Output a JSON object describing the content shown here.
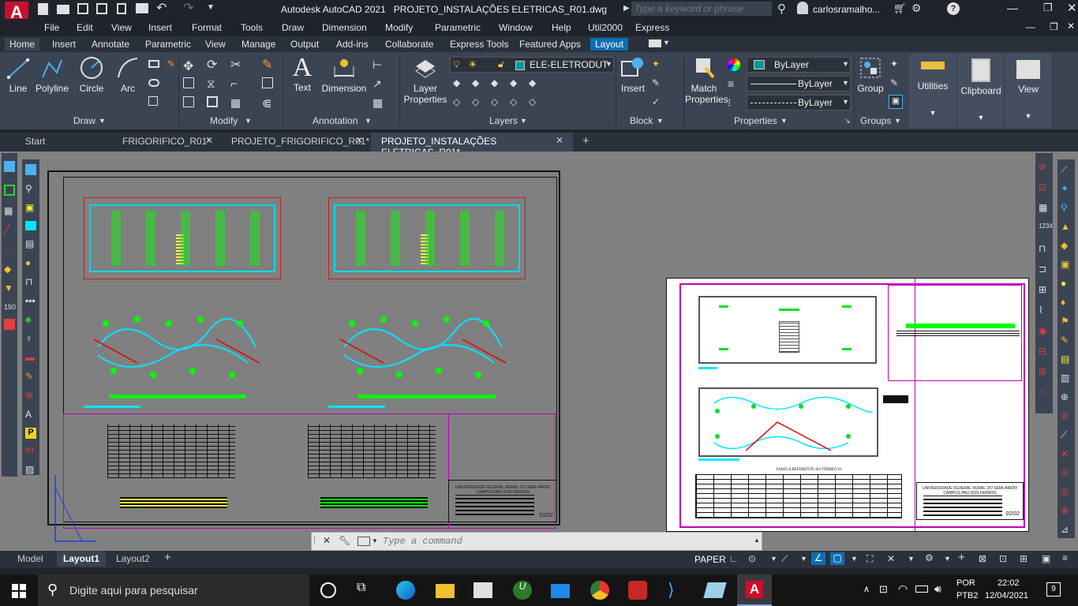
{
  "app": {
    "title": "Autodesk AutoCAD 2021",
    "filename": "PROJETO_INSTALAÇÕES ELETRICAS_R01.dwg",
    "search_placeholder": "Type a keyword or phrase",
    "user": "carlosramalho...",
    "logo_letter": "A"
  },
  "menu": [
    "File",
    "Edit",
    "View",
    "Insert",
    "Format",
    "Tools",
    "Draw",
    "Dimension",
    "Modify",
    "Parametric",
    "Window",
    "Help",
    "Util2000",
    "Express"
  ],
  "ribbon_tabs": [
    "Home",
    "Insert",
    "Annotate",
    "Parametric",
    "View",
    "Manage",
    "Output",
    "Add-ins",
    "Collaborate",
    "Express Tools",
    "Featured Apps",
    "Layout"
  ],
  "ribbon": {
    "draw": {
      "line": "Line",
      "polyline": "Polyline",
      "circle": "Circle",
      "arc": "Arc",
      "label": "Draw"
    },
    "modify": {
      "label": "Modify"
    },
    "annotation": {
      "text": "Text",
      "dimension": "Dimension",
      "label": "Annotation"
    },
    "layers": {
      "layer_properties_1": "Layer",
      "layer_properties_2": "Properties",
      "current_layer": "ELE-ELETRODUT",
      "label": "Layers"
    },
    "block": {
      "insert": "Insert",
      "label": "Block"
    },
    "properties": {
      "match_1": "Match",
      "match_2": "Properties",
      "color": "ByLayer",
      "lineweight": "ByLayer",
      "linetype": "ByLayer",
      "label": "Properties"
    },
    "groups": {
      "group": "Group",
      "label": "Groups"
    },
    "utilities": "Utilities",
    "clipboard": "Clipboard",
    "view": "View"
  },
  "doc_tabs": [
    "Start",
    "FRIGORIFICO_R01*",
    "PROJETO_FRIGORIFICO_R01*",
    "PROJETO_INSTALAÇÕES ELETRICAS_R01*"
  ],
  "sheet": {
    "university_1": "UNIVERSIDADE FEDERAL RURAL DO SEMI-ÁRIDO",
    "campus_1": "CAMPUS PAU DOS FERROS",
    "sheet_1": "01/02",
    "university_2": "UNIVERSIDADE FEDERAL RURAL DO SEMI-ÁRIDO",
    "campus_2": "CAMPUS PAU DOS FERROS",
    "sheet_2": "02/02",
    "table_title": "TABELA REFERENTE AO TÉRREO 01"
  },
  "command": {
    "placeholder": "Type a command"
  },
  "layout_tabs": [
    "Model",
    "Layout1",
    "Layout2"
  ],
  "status": {
    "paper": "PAPER"
  },
  "taskbar": {
    "search_placeholder": "Digite aqui para pesquisar",
    "lang_1": "POR",
    "lang_2": "PTB2",
    "time": "22:02",
    "date": "12/04/2021",
    "notifications": "9"
  },
  "colors": {
    "accent": "#0c6fb5",
    "ribbon_bg": "#3b4453",
    "paper": "#ffffff",
    "workspace": "#808080",
    "magenta": "#c000c0",
    "cyan": "#00e5ff",
    "green": "#00ff00",
    "red": "#e00000"
  }
}
